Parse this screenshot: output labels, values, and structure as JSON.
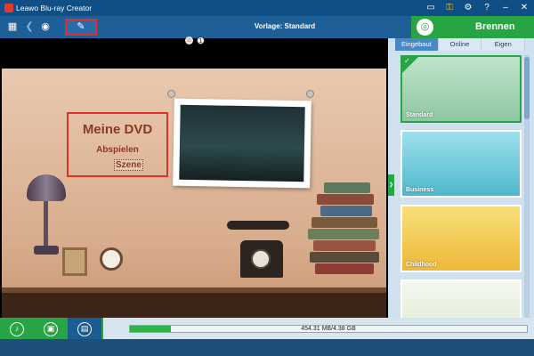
{
  "window": {
    "title": "Leawo Blu-ray Creator"
  },
  "titlebar_icons": [
    "chat-icon",
    "key-icon",
    "gear-icon",
    "help-icon",
    "minimize-icon",
    "close-icon"
  ],
  "toolbar": {
    "template_label": "Vorlage: Standard",
    "burn_label": "Brennen"
  },
  "menu": {
    "title": "Meine DVD",
    "play": "Abspielen",
    "scene": "Szene",
    "page_number": "1"
  },
  "tabs": [
    {
      "label": "Eingebaut",
      "active": true
    },
    {
      "label": "Online",
      "active": false
    },
    {
      "label": "Eigen",
      "active": false
    }
  ],
  "templates": [
    {
      "name": "Standard",
      "selected": true,
      "color": "#8fc7a4"
    },
    {
      "name": "Business",
      "selected": false,
      "color": "#62c4d6"
    },
    {
      "name": "Childhood",
      "selected": false,
      "color": "#f1c84b"
    },
    {
      "name": "",
      "selected": false,
      "color": "#e8f1e0"
    }
  ],
  "bottom": {
    "progress_text": "454.31 MB/4.38 GB",
    "progress_fraction": 0.103
  },
  "colors": {
    "accent_green": "#27a544",
    "title_blue": "#0f4f86",
    "highlight_red": "#e0302a"
  }
}
